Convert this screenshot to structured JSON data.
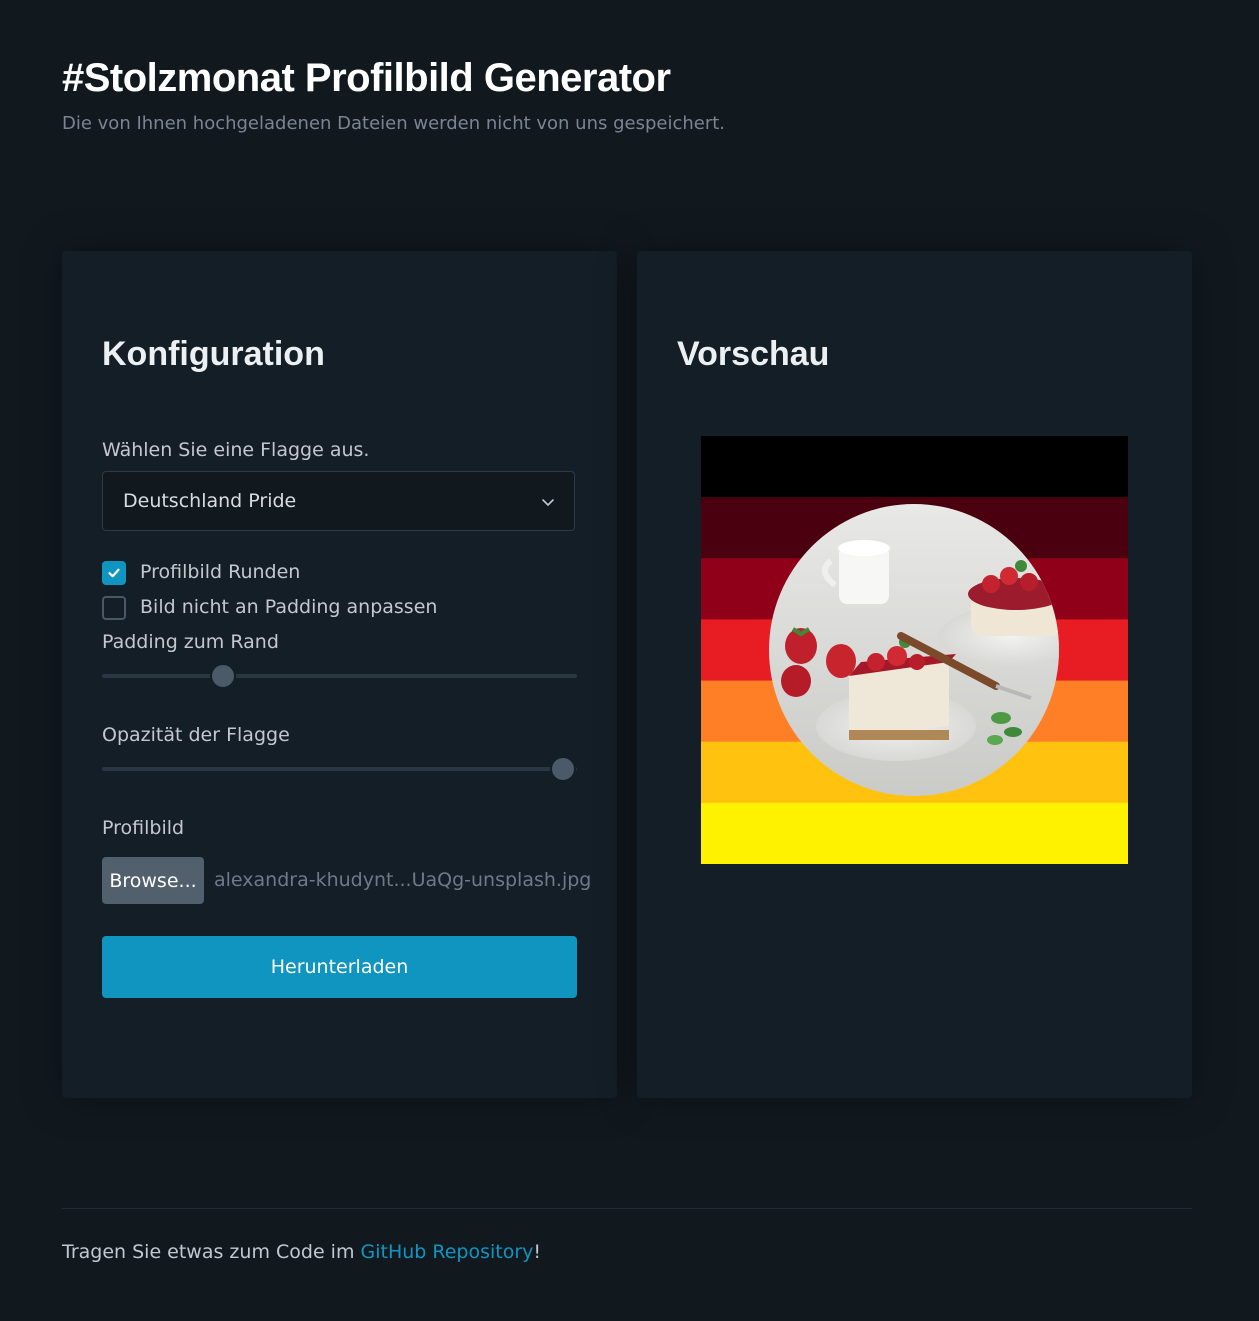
{
  "header": {
    "title": "#Stolzmonat Profilbild Generator",
    "subtitle": "Die von Ihnen hochgeladenen Dateien werden nicht von uns gespeichert."
  },
  "config": {
    "heading": "Konfiguration",
    "flag_label": "Wählen Sie eine Flagge aus.",
    "flag_selected": "Deutschland Pride",
    "round_label": "Profilbild Runden",
    "round_checked": true,
    "nofit_label": "Bild nicht an Padding anpassen",
    "nofit_checked": false,
    "padding_label": "Padding zum Rand",
    "padding_value_fraction": 0.255,
    "opacity_label": "Opazität der Flagge",
    "opacity_value_fraction": 0.97,
    "profile_label": "Profilbild",
    "browse_label": "Browse...",
    "filename": "alexandra-khudynt...UaQg-unsplash.jpg",
    "download_label": "Herunterladen"
  },
  "preview": {
    "heading": "Vorschau",
    "flag_stripes": [
      "#000000",
      "#4b0010",
      "#910019",
      "#e81c23",
      "#ff7f27",
      "#ffc30f",
      "#fff200"
    ]
  },
  "footer": {
    "text_before": "Tragen Sie etwas zum Code im ",
    "link_text": "GitHub Repository",
    "text_after": "!"
  },
  "colors": {
    "accent": "#1095c1",
    "background": "#11191f",
    "card": "#141e26"
  }
}
